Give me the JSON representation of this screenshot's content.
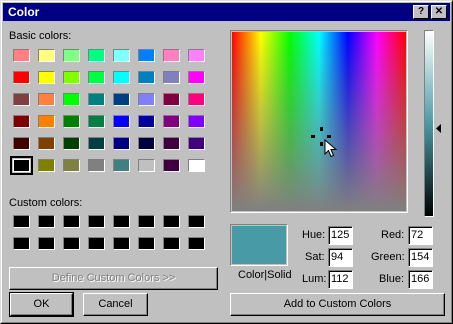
{
  "window": {
    "title": "Color",
    "help_button": "?",
    "close_button": "✕"
  },
  "labels": {
    "basic_colors": "Basic colors:",
    "custom_colors": "Custom colors:",
    "color_solid": "Color|Solid"
  },
  "basic_colors": [
    [
      "#ff8080",
      "#ffff80",
      "#80ff80",
      "#00ff80",
      "#80ffff",
      "#0080ff",
      "#ff80c0",
      "#ff80ff"
    ],
    [
      "#ff0000",
      "#ffff00",
      "#80ff00",
      "#00ff40",
      "#00ffff",
      "#0080c0",
      "#8080c0",
      "#ff00ff"
    ],
    [
      "#804040",
      "#ff8040",
      "#00ff00",
      "#008080",
      "#004080",
      "#8080ff",
      "#800040",
      "#ff0080"
    ],
    [
      "#800000",
      "#ff8000",
      "#008000",
      "#008040",
      "#0000ff",
      "#0000a0",
      "#800080",
      "#8000ff"
    ],
    [
      "#400000",
      "#804000",
      "#004000",
      "#004040",
      "#000080",
      "#000040",
      "#400040",
      "#400080"
    ],
    [
      "#000000",
      "#808000",
      "#808040",
      "#808080",
      "#408080",
      "#c0c0c0",
      "#400040",
      "#ffffff"
    ]
  ],
  "selected_basic": "#000000",
  "custom_colors": [
    [
      "#000000",
      "#000000",
      "#000000",
      "#000000",
      "#000000",
      "#000000",
      "#000000",
      "#000000"
    ],
    [
      "#000000",
      "#000000",
      "#000000",
      "#000000",
      "#000000",
      "#000000",
      "#000000",
      "#000000"
    ]
  ],
  "buttons": {
    "define_custom": "Define Custom Colors >>",
    "ok": "OK",
    "cancel": "Cancel",
    "add_custom": "Add to Custom Colors"
  },
  "current_color": "#489aa6",
  "fields": {
    "hue": {
      "label": "Hue:",
      "value": "125"
    },
    "sat": {
      "label": "Sat:",
      "value": "94"
    },
    "lum": {
      "label": "Lum:",
      "value": "112"
    },
    "red": {
      "label": "Red:",
      "value": "72"
    },
    "green": {
      "label": "Green:",
      "value": "154"
    },
    "blue": {
      "label": "Blue:",
      "value": "166"
    }
  }
}
